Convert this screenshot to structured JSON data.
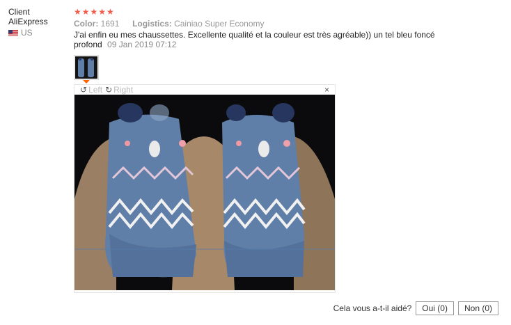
{
  "reviewer": {
    "name": "Client AliExpress",
    "country": "US"
  },
  "review": {
    "stars": "★★★★★",
    "color_label": "Color:",
    "color_value": "1691",
    "logistics_label": "Logistics:",
    "logistics_value": "Cainiao Super Economy",
    "text": "J'ai enfin eu mes chaussettes. Excellente qualité et la couleur est très agréable)) un tel bleu foncé profond",
    "date": "09 Jan 2019 07:12"
  },
  "viewer": {
    "left_label": "Left",
    "right_label": "Right",
    "close_glyph": "×"
  },
  "feedback": {
    "question": "Cela vous a-t-il aidé?",
    "yes_label": "Oui (0)",
    "no_label": "Non (0)"
  },
  "colors": {
    "stars": "#f25d4b",
    "thumb_indicator": "#ff6600",
    "sock_blue": "#5f7fa8"
  }
}
